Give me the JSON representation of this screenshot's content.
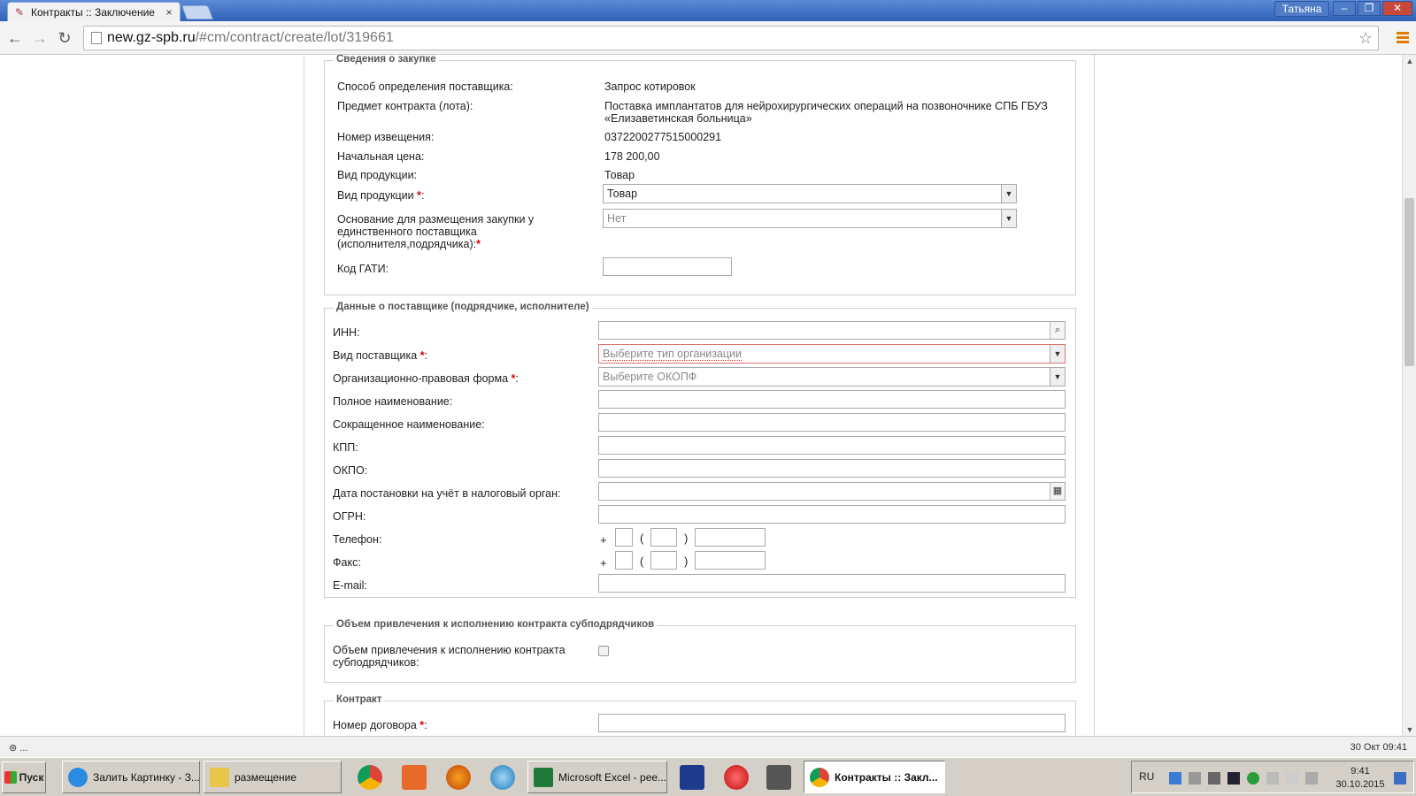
{
  "browser": {
    "tab_title": "Контракты :: Заключение",
    "tab_close": "×",
    "user": "Татьяна",
    "url_host": "new.gz-spb.ru",
    "url_path": "/#cm/contract/create/lot/319661",
    "icons": {
      "back": "back-arrow-icon",
      "forward": "forward-arrow-icon",
      "reload": "reload-icon",
      "star": "star-icon",
      "menu": "menu-icon"
    }
  },
  "window_controls": {
    "minimize": "–",
    "restore": "❐",
    "close": "✕"
  },
  "purchase": {
    "legend": "Сведения о закупке",
    "method_label": "Способ определения поставщика:",
    "method_value": "Запрос котировок",
    "subject_label": "Предмет контракта (лота):",
    "subject_value_1": "Поставка имплантатов для нейрохирургических операций на позвоночнике СПБ ГБУЗ",
    "subject_value_2": "«Елизаветинская больница»",
    "notice_label": "Номер извещения:",
    "notice_value": "0372200277515000291",
    "price_label": "Начальная цена:",
    "price_value": "178 200,00",
    "product_type_label": "Вид продукции:",
    "product_type_value": "Товар",
    "product_type_select_label": "Вид продукции",
    "product_type_select_value": "Товар",
    "basis_label_1": "Основание для размещения закупки у",
    "basis_label_2": "единственного поставщика",
    "basis_label_3": "(исполнителя,подрядчика):",
    "basis_value": "Нет",
    "gati_label": "Код ГАТИ:",
    "gati_value": ""
  },
  "supplier": {
    "legend": "Данные о поставщике (подрядчике, исполнителе)",
    "inn_label": "ИНН:",
    "kind_label": "Вид поставщика",
    "kind_placeholder": "Выберите тип организации",
    "org_form_label": "Организационно-правовая форма",
    "org_form_placeholder": "Выберите ОКОПФ",
    "full_name_label": "Полное наименование:",
    "short_name_label": "Сокращенное наименование:",
    "kpp_label": "КПП:",
    "okpo_label": "ОКПО:",
    "tax_date_label": "Дата постановки на учёт в налоговый орган:",
    "ogrn_label": "ОГРН:",
    "phone_label": "Телефон:",
    "fax_label": "Факс:",
    "email_label": "E-mail:",
    "plus": "+",
    "lparen": "(",
    "rparen": ")"
  },
  "subcontract": {
    "legend": "Объем привлечения к исполнению контракта субподрядчиков",
    "label_1": "Объем привлечения к исполнению контракта",
    "label_2": "субподрядчиков:"
  },
  "contract": {
    "legend": "Контракт",
    "number_label": "Номер договора"
  },
  "common": {
    "required_mark": "*",
    "colon": ":"
  },
  "status": {
    "left": "⊚ ...",
    "right": "30 Окт 09:41"
  },
  "taskbar": {
    "start": "Пуск",
    "tasks": [
      "Залить Картинку - З...",
      "размещение",
      "Microsoft Excel - рее...",
      "Контракты :: Закл..."
    ],
    "lang": "RU",
    "time": "9:41",
    "date": "30.10.2015"
  },
  "colors": {
    "accent": "#2f62b8",
    "required": "#dd0000",
    "error_border": "#e07070"
  }
}
